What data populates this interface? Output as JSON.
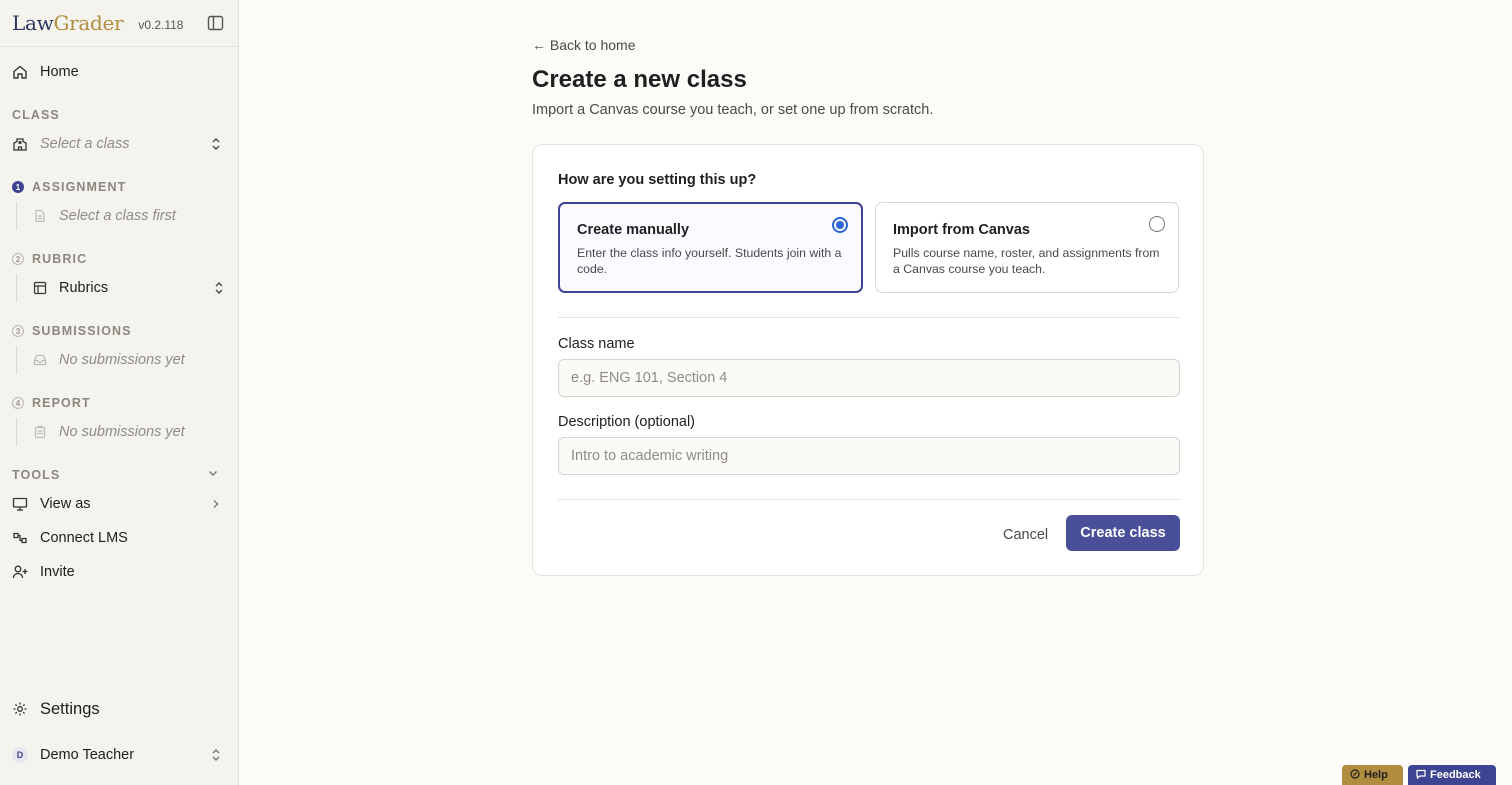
{
  "app": {
    "logo_part1": "Law",
    "logo_part2": "Grader",
    "version": "v0.2.118"
  },
  "sidebar": {
    "home_label": "Home",
    "class_section": "CLASS",
    "class_select_placeholder": "Select a class",
    "assignment_section": "ASSIGNMENT",
    "assignment_step": "1",
    "assignment_placeholder": "Select a class first",
    "rubric_section": "RUBRIC",
    "rubric_step": "2",
    "rubric_item": "Rubrics",
    "submissions_section": "SUBMISSIONS",
    "submissions_step": "3",
    "submissions_placeholder": "No submissions yet",
    "report_section": "REPORT",
    "report_step": "4",
    "report_placeholder": "No submissions yet",
    "tools_section": "TOOLS",
    "view_as": "View as",
    "connect_lms": "Connect LMS",
    "invite": "Invite",
    "settings": "Settings",
    "user_initial": "D",
    "user_name": "Demo Teacher"
  },
  "main": {
    "back_link": "← Back to home",
    "title": "Create a new class",
    "subtitle": "Import a Canvas course you teach, or set one up from scratch.",
    "question": "How are you setting this up?",
    "option_manual_title": "Create manually",
    "option_manual_desc": "Enter the class info yourself. Students join with a code.",
    "option_canvas_title": "Import from Canvas",
    "option_canvas_desc": "Pulls course name, roster, and assignments from a Canvas course you teach.",
    "selected_option": "Create manually",
    "class_name_label": "Class name",
    "class_name_value": "",
    "class_name_placeholder": "e.g. ENG 101, Section 4",
    "description_label": "Description (optional)",
    "description_value": "",
    "description_placeholder": "Intro to academic writing",
    "cancel_label": "Cancel",
    "create_label": "Create class"
  },
  "floating": {
    "help_label": "Help",
    "feedback_label": "Feedback"
  },
  "colors": {
    "accent": "#4a4f9a",
    "brand_navy": "#2e3761",
    "brand_gold": "#b08d3f"
  }
}
